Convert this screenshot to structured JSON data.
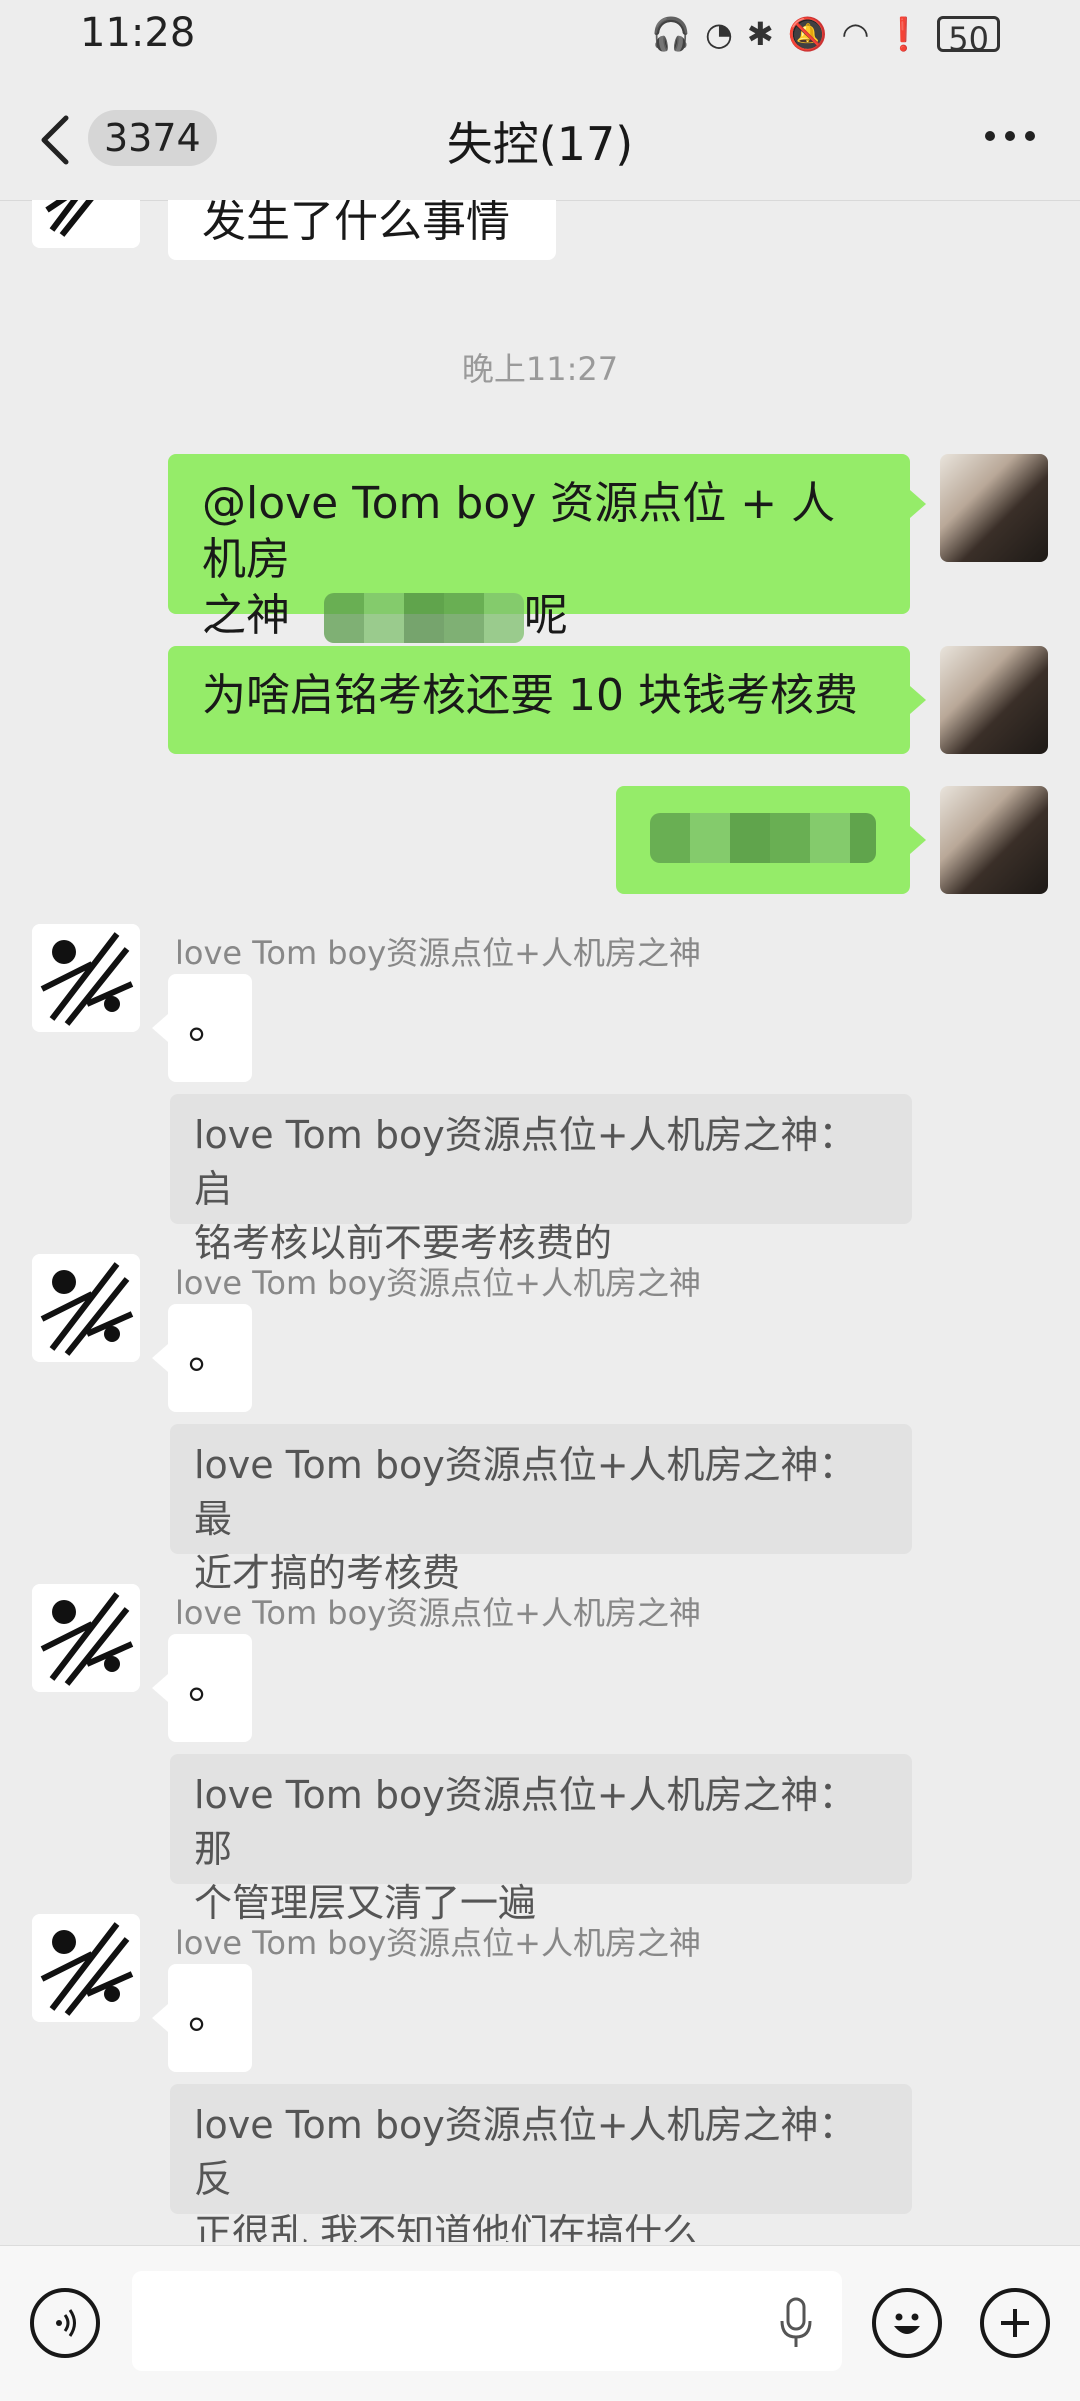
{
  "status_bar": {
    "time": "11:28",
    "battery": "50"
  },
  "header": {
    "unread_count": "3374",
    "title": "失控(17)"
  },
  "chat": {
    "partial_top_message": "发生了什么事情",
    "timestamp": "晚上11:27",
    "self_messages": [
      {
        "line1": "@love Tom boy 资源点位 + 人机房",
        "line2_prefix": "之神",
        "line2_suffix": "呢"
      },
      {
        "text": "为啥启铭考核还要 10 块钱考核费"
      },
      {
        "text": ""
      }
    ],
    "others": [
      {
        "sender": "love Tom boy资源点位+人机房之神",
        "message": "。",
        "quote_line1": "love Tom boy资源点位+人机房之神：启",
        "quote_line2": "铭考核以前不要考核费的"
      },
      {
        "sender": "love Tom boy资源点位+人机房之神",
        "message": "。",
        "quote_line1": "love Tom boy资源点位+人机房之神：最",
        "quote_line2": "近才搞的考核费"
      },
      {
        "sender": "love Tom boy资源点位+人机房之神",
        "message": "。",
        "quote_line1": "love Tom boy资源点位+人机房之神：那",
        "quote_line2": "个管理层又清了一遍"
      },
      {
        "sender": "love Tom boy资源点位+人机房之神",
        "message": "。",
        "quote_line1": "love Tom boy资源点位+人机房之神：反",
        "quote_line2": "正很乱 我不知道他们在搞什么"
      }
    ]
  },
  "input_bar": {
    "placeholder": ""
  },
  "colors": {
    "self_bubble": "#95ec69",
    "background": "#ededed",
    "other_bubble": "#ffffff",
    "quote_bg": "#e2e2e2"
  }
}
